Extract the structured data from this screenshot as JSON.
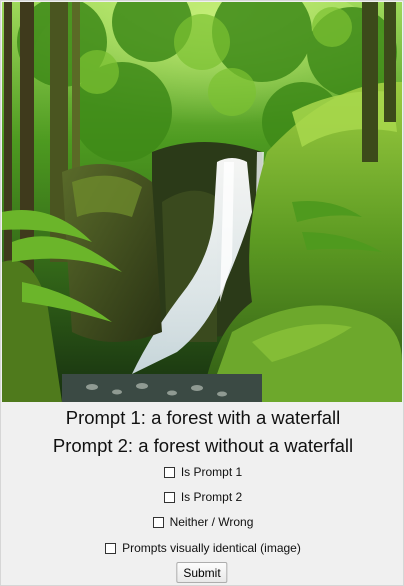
{
  "image": {
    "subject": "forest-waterfall-photo"
  },
  "prompts": {
    "prompt1": "Prompt 1: a forest with a waterfall",
    "prompt2": "Prompt 2: a forest without a waterfall"
  },
  "options": [
    {
      "label": "Is Prompt 1",
      "checked": false
    },
    {
      "label": "Is Prompt 2",
      "checked": false
    },
    {
      "label": "Neither / Wrong",
      "checked": false
    },
    {
      "label": "Prompts visually identical (image)",
      "checked": false
    }
  ],
  "submit_label": "Submit",
  "colors": {
    "background": "#f0f0f0",
    "foliage": "#4f9a1e",
    "moss": "#6aa629",
    "water": "#e8f0f4"
  }
}
